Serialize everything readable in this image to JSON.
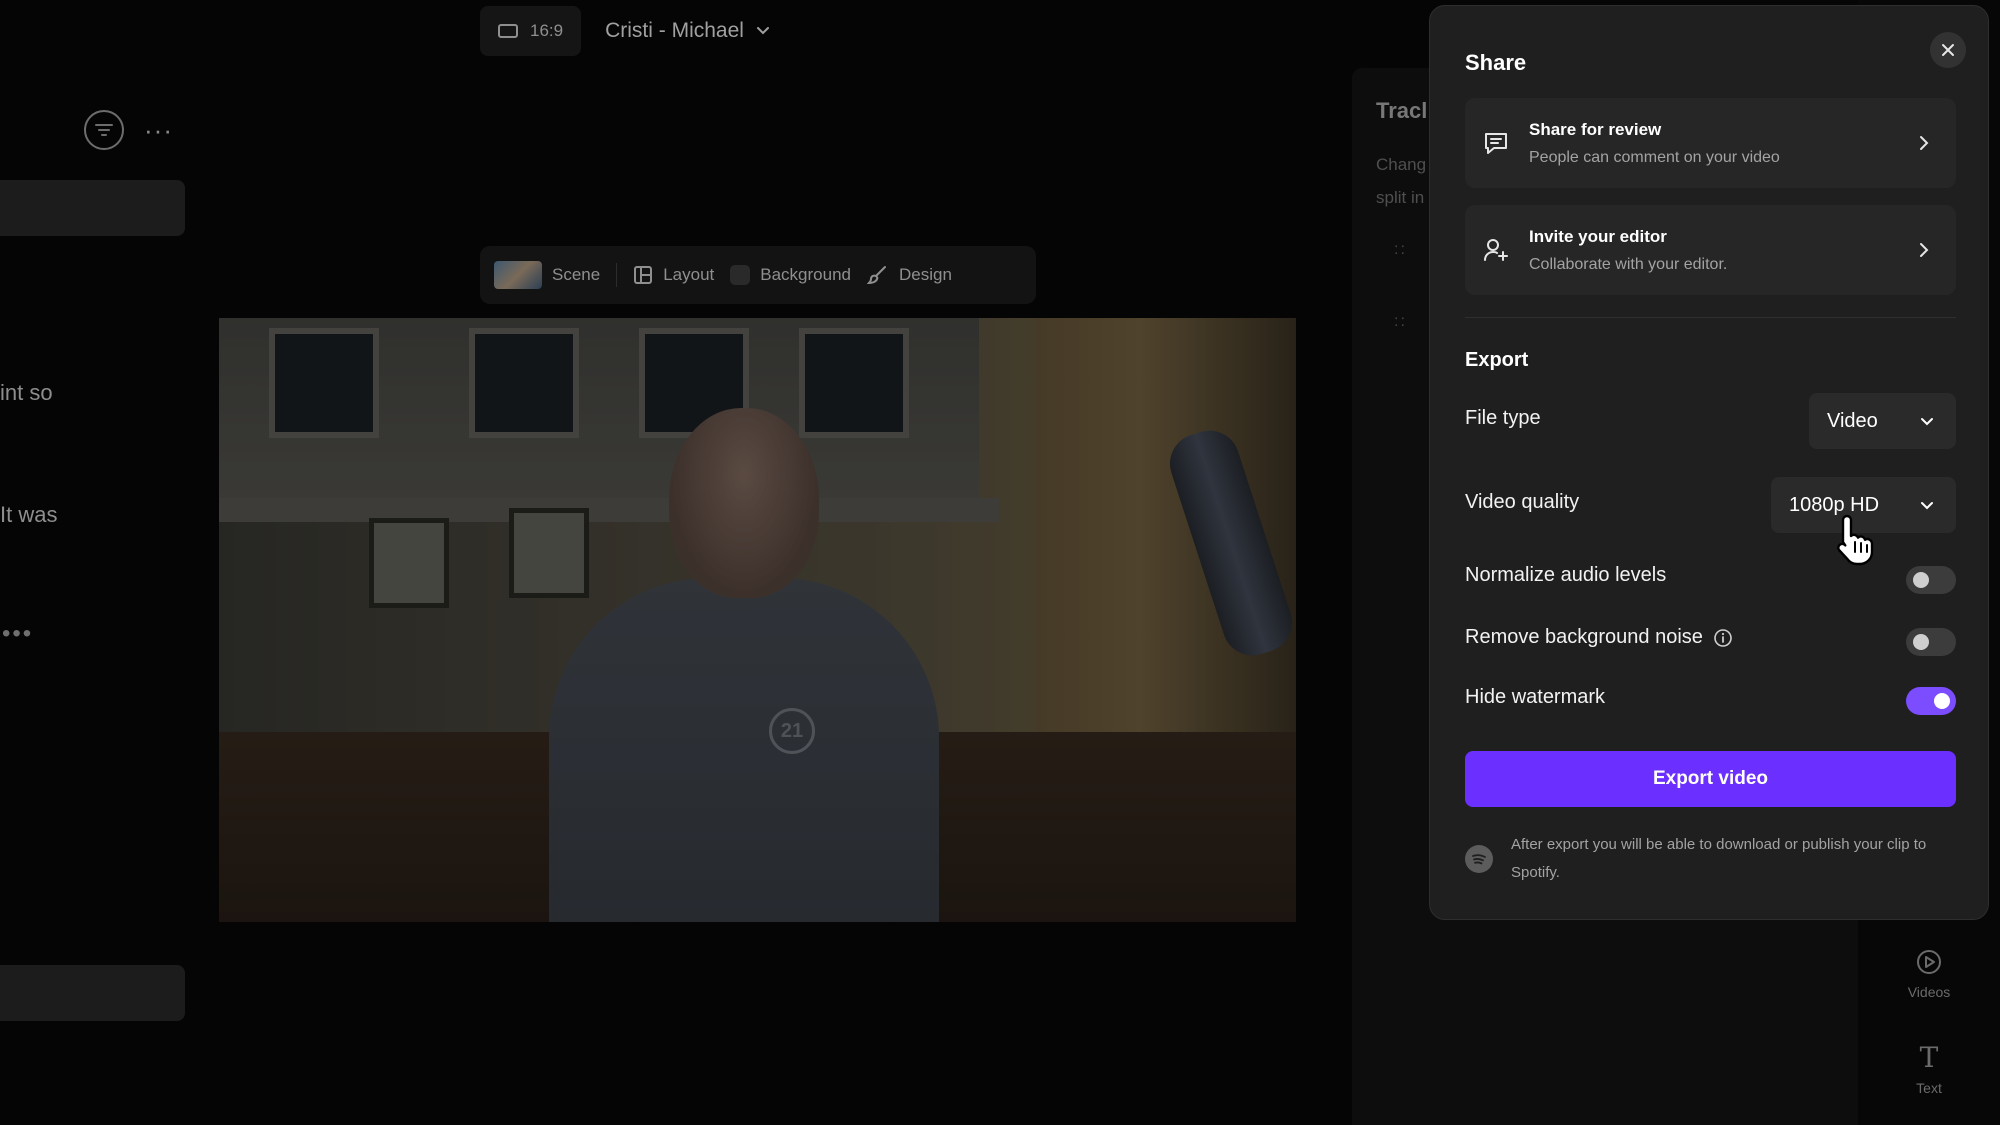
{
  "editor": {
    "aspect_ratio": "16:9",
    "project_name": "Cristi - Michael",
    "left_panel": {
      "text_lines": [
        "int so",
        "It was"
      ]
    },
    "scene_toolbar": {
      "scene": "Scene",
      "layout": "Layout",
      "background": "Background",
      "design": "Design"
    },
    "tracks_panel": {
      "title": "Tracl",
      "description_lines": [
        "Chang",
        "split in"
      ]
    },
    "right_rail": {
      "videos": "Videos",
      "text": "Text"
    },
    "video_logo_text": "21"
  },
  "share": {
    "title": "Share",
    "options": [
      {
        "title": "Share for review",
        "subtitle": "People can comment on your video",
        "icon": "comment-icon"
      },
      {
        "title": "Invite your editor",
        "subtitle": "Collaborate with your editor.",
        "icon": "user-plus-icon"
      }
    ],
    "export": {
      "title": "Export",
      "file_type_label": "File type",
      "file_type_value": "Video",
      "video_quality_label": "Video quality",
      "video_quality_value": "1080p HD",
      "toggles": [
        {
          "label": "Normalize audio levels",
          "on": false
        },
        {
          "label": "Remove background noise",
          "on": false,
          "has_info": true
        },
        {
          "label": "Hide watermark",
          "on": true
        }
      ],
      "export_button": "Export video",
      "footnote": "After export you will be able to download or publish your clip to Spotify."
    }
  },
  "colors": {
    "accent": "#6b2fff",
    "toggle_on": "#7c4dff",
    "modal_bg": "#1f1f1f"
  }
}
